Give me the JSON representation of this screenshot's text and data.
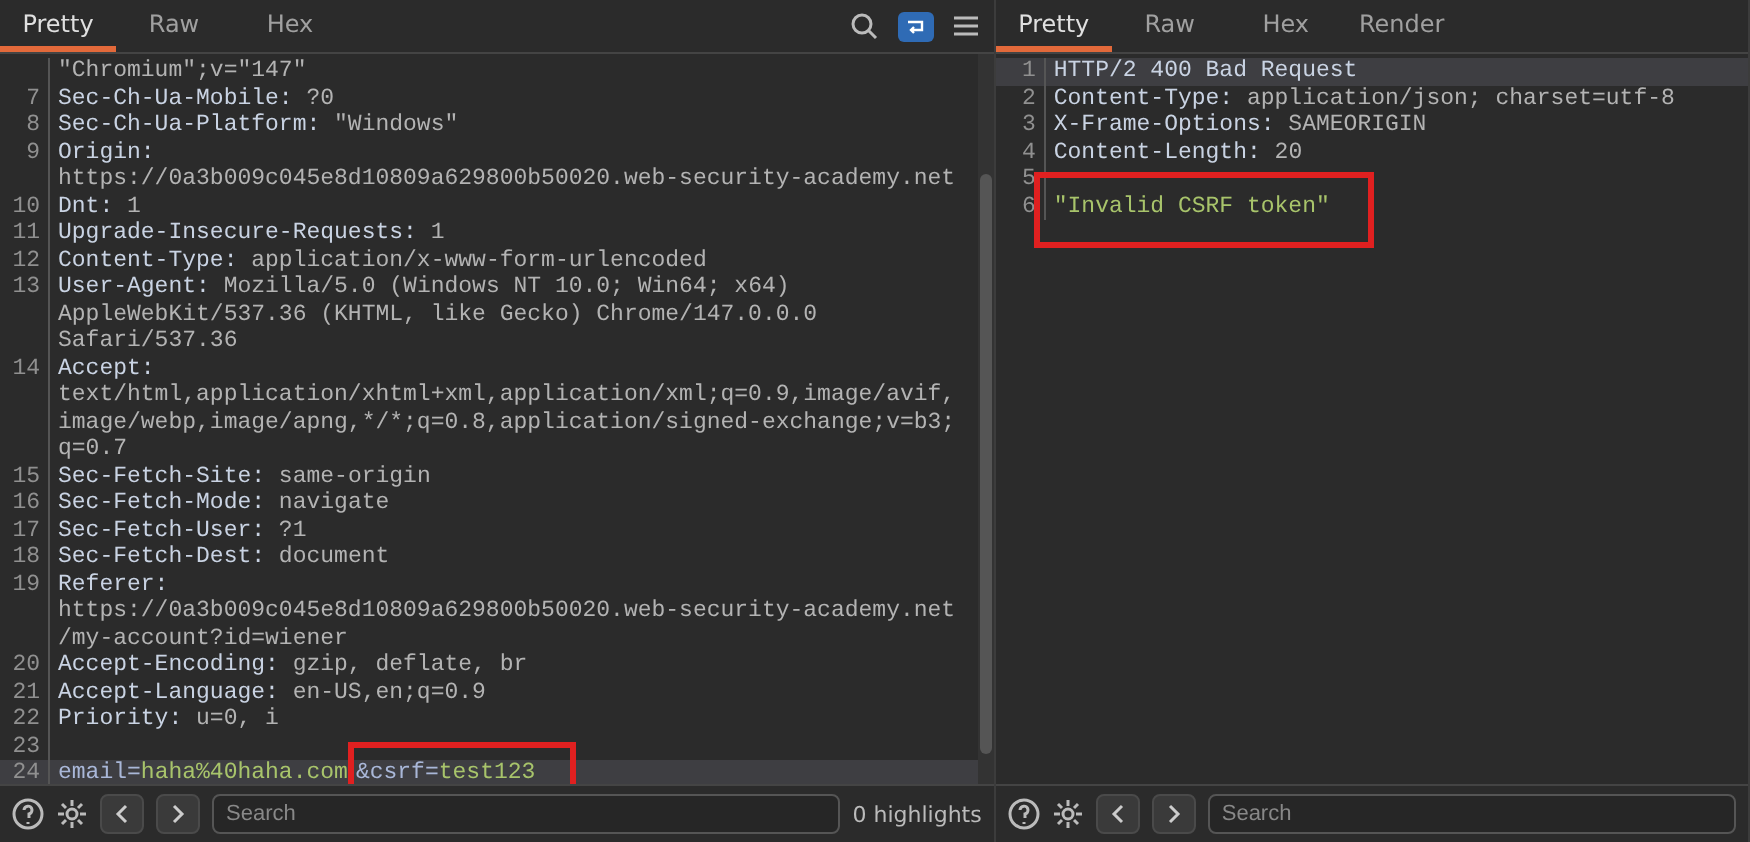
{
  "request": {
    "tabs": [
      {
        "label": "Pretty",
        "selected": true
      },
      {
        "label": "Raw",
        "selected": false
      },
      {
        "label": "Hex",
        "selected": false
      }
    ],
    "lines": [
      {
        "current": false,
        "parts": [
          {
            "kind": "value",
            "text": "\"Chromium\";v=\"147\""
          }
        ]
      },
      {
        "num": "7",
        "current": false,
        "parts": [
          {
            "kind": "name",
            "text": "Sec-Ch-Ua-Mobile:"
          },
          {
            "kind": "value",
            "text": " ?0"
          }
        ]
      },
      {
        "num": "8",
        "current": false,
        "parts": [
          {
            "kind": "name",
            "text": "Sec-Ch-Ua-Platform:"
          },
          {
            "kind": "value",
            "text": " \"Windows\""
          }
        ]
      },
      {
        "num": "9",
        "current": false,
        "parts": [
          {
            "kind": "name",
            "text": "Origin:"
          }
        ]
      },
      {
        "current": false,
        "parts": [
          {
            "kind": "value",
            "text": "https://0a3b009c045e8d10809a629800b50020.web-security-academy.net"
          }
        ]
      },
      {
        "num": "10",
        "current": false,
        "parts": [
          {
            "kind": "name",
            "text": "Dnt:"
          },
          {
            "kind": "value",
            "text": " 1"
          }
        ]
      },
      {
        "num": "11",
        "current": false,
        "parts": [
          {
            "kind": "name",
            "text": "Upgrade-Insecure-Requests:"
          },
          {
            "kind": "value",
            "text": " 1"
          }
        ]
      },
      {
        "num": "12",
        "current": false,
        "parts": [
          {
            "kind": "name",
            "text": "Content-Type:"
          },
          {
            "kind": "value",
            "text": " application/x-www-form-urlencoded"
          }
        ]
      },
      {
        "num": "13",
        "current": false,
        "parts": [
          {
            "kind": "name",
            "text": "User-Agent:"
          },
          {
            "kind": "value",
            "text": " Mozilla/5.0 (Windows NT 10.0; Win64; x64)"
          }
        ]
      },
      {
        "current": false,
        "parts": [
          {
            "kind": "value",
            "text": "AppleWebKit/537.36 (KHTML, like Gecko) Chrome/147.0.0.0"
          }
        ]
      },
      {
        "current": false,
        "parts": [
          {
            "kind": "value",
            "text": "Safari/537.36"
          }
        ]
      },
      {
        "num": "14",
        "current": false,
        "parts": [
          {
            "kind": "name",
            "text": "Accept:"
          }
        ]
      },
      {
        "current": false,
        "parts": [
          {
            "kind": "value",
            "text": "text/html,application/xhtml+xml,application/xml;q=0.9,image/avif,"
          }
        ]
      },
      {
        "current": false,
        "parts": [
          {
            "kind": "value",
            "text": "image/webp,image/apng,*/*;q=0.8,application/signed-exchange;v=b3;"
          }
        ]
      },
      {
        "current": false,
        "parts": [
          {
            "kind": "value",
            "text": "q=0.7"
          }
        ]
      },
      {
        "num": "15",
        "current": false,
        "parts": [
          {
            "kind": "name",
            "text": "Sec-Fetch-Site:"
          },
          {
            "kind": "value",
            "text": " same-origin"
          }
        ]
      },
      {
        "num": "16",
        "current": false,
        "parts": [
          {
            "kind": "name",
            "text": "Sec-Fetch-Mode:"
          },
          {
            "kind": "value",
            "text": " navigate"
          }
        ]
      },
      {
        "num": "17",
        "current": false,
        "parts": [
          {
            "kind": "name",
            "text": "Sec-Fetch-User:"
          },
          {
            "kind": "value",
            "text": " ?1"
          }
        ]
      },
      {
        "num": "18",
        "current": false,
        "parts": [
          {
            "kind": "name",
            "text": "Sec-Fetch-Dest:"
          },
          {
            "kind": "value",
            "text": " document"
          }
        ]
      },
      {
        "num": "19",
        "current": false,
        "parts": [
          {
            "kind": "name",
            "text": "Referer:"
          }
        ]
      },
      {
        "current": false,
        "parts": [
          {
            "kind": "value",
            "text": "https://0a3b009c045e8d10809a629800b50020.web-security-academy.net"
          }
        ]
      },
      {
        "current": false,
        "parts": [
          {
            "kind": "value",
            "text": "/my-account?id=wiener"
          }
        ]
      },
      {
        "num": "20",
        "current": false,
        "parts": [
          {
            "kind": "name",
            "text": "Accept-Encoding:"
          },
          {
            "kind": "value",
            "text": " gzip, deflate, br"
          }
        ]
      },
      {
        "num": "21",
        "current": false,
        "parts": [
          {
            "kind": "name",
            "text": "Accept-Language:"
          },
          {
            "kind": "value",
            "text": " en-US,en;q=0.9"
          }
        ]
      },
      {
        "num": "22",
        "current": false,
        "parts": [
          {
            "kind": "name",
            "text": "Priority:"
          },
          {
            "kind": "value",
            "text": " u=0, i"
          }
        ]
      },
      {
        "num": "23",
        "current": false
      },
      {
        "num": "24",
        "current": true,
        "parts": [
          {
            "kind": "param",
            "text": "email="
          },
          {
            "kind": "string",
            "text": "haha%40haha.com"
          },
          {
            "kind": "param",
            "text": "&csrf=",
            "boxed": true
          },
          {
            "kind": "string",
            "text": "test123",
            "boxed": true
          }
        ]
      }
    ],
    "search": {
      "placeholder": "Search"
    },
    "highlights": "0 highlights"
  },
  "response": {
    "tabs": [
      {
        "label": "Pretty",
        "selected": true
      },
      {
        "label": "Raw",
        "selected": false
      },
      {
        "label": "Hex",
        "selected": false
      },
      {
        "label": "Render",
        "selected": false
      }
    ],
    "lines": [
      {
        "num": "1",
        "current": true,
        "parts": [
          {
            "kind": "name",
            "text": "HTTP/2 400 Bad Request"
          }
        ]
      },
      {
        "num": "2",
        "current": false,
        "parts": [
          {
            "kind": "name",
            "text": "Content-Type:"
          },
          {
            "kind": "value",
            "text": " application/json; charset=utf-8"
          }
        ]
      },
      {
        "num": "3",
        "current": false,
        "parts": [
          {
            "kind": "name",
            "text": "X-Frame-Options:"
          },
          {
            "kind": "value",
            "text": " SAMEORIGIN"
          }
        ]
      },
      {
        "num": "4",
        "current": false,
        "parts": [
          {
            "kind": "name",
            "text": "Content-Length:"
          },
          {
            "kind": "value",
            "text": " 20"
          }
        ]
      },
      {
        "num": "5",
        "current": false
      },
      {
        "num": "6",
        "current": false,
        "parts": [
          {
            "kind": "string",
            "text": "\"Invalid CSRF token\"",
            "boxed": true
          }
        ]
      }
    ],
    "search": {
      "placeholder": "Search"
    }
  }
}
